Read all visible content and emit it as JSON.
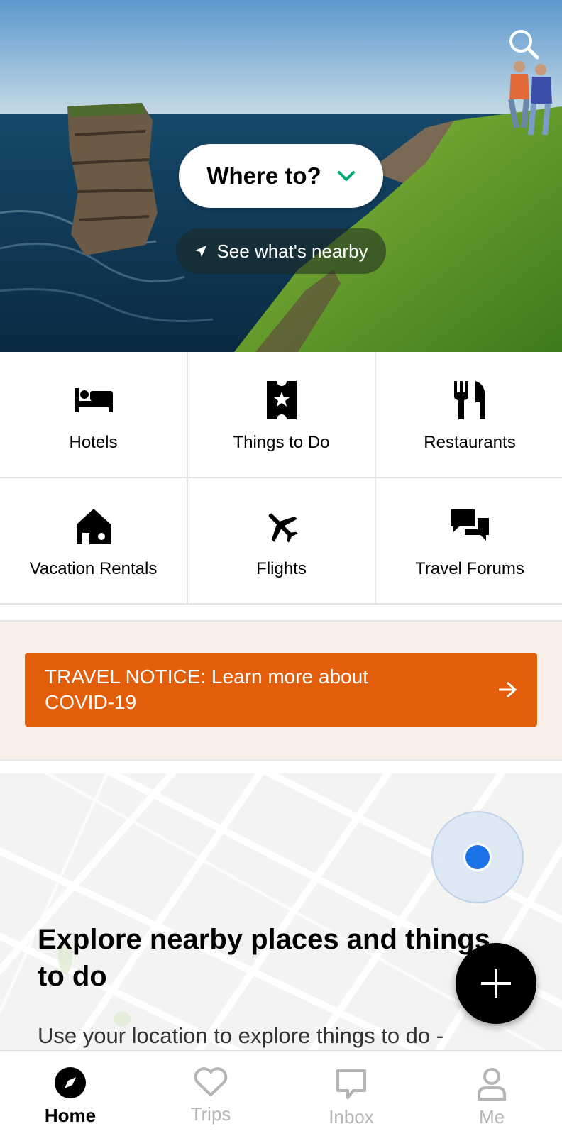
{
  "hero": {
    "where_label": "Where to?",
    "nearby_label": "See what's nearby",
    "colors": {
      "chevron": "#00aa6c"
    }
  },
  "categories": [
    {
      "label": "Hotels",
      "icon": "bed-icon"
    },
    {
      "label": "Things to Do",
      "icon": "ticket-icon"
    },
    {
      "label": "Restaurants",
      "icon": "fork-knife-icon"
    },
    {
      "label": "Vacation Rentals",
      "icon": "house-icon"
    },
    {
      "label": "Flights",
      "icon": "airplane-icon"
    },
    {
      "label": "Travel Forums",
      "icon": "chat-bubbles-icon"
    }
  ],
  "notice": {
    "label": "TRAVEL NOTICE: Learn more about COVID-19",
    "color": "#e35e0b"
  },
  "explore": {
    "title": "Explore nearby places and things to do",
    "subtitle": "Use your location to explore things to do -",
    "location_dot_color": "#1a73e8"
  },
  "nav": {
    "items": [
      {
        "label": "Home",
        "icon": "compass-icon",
        "active": true
      },
      {
        "label": "Trips",
        "icon": "heart-icon",
        "active": false
      },
      {
        "label": "Inbox",
        "icon": "inbox-icon",
        "active": false
      },
      {
        "label": "Me",
        "icon": "person-icon",
        "active": false
      }
    ]
  }
}
